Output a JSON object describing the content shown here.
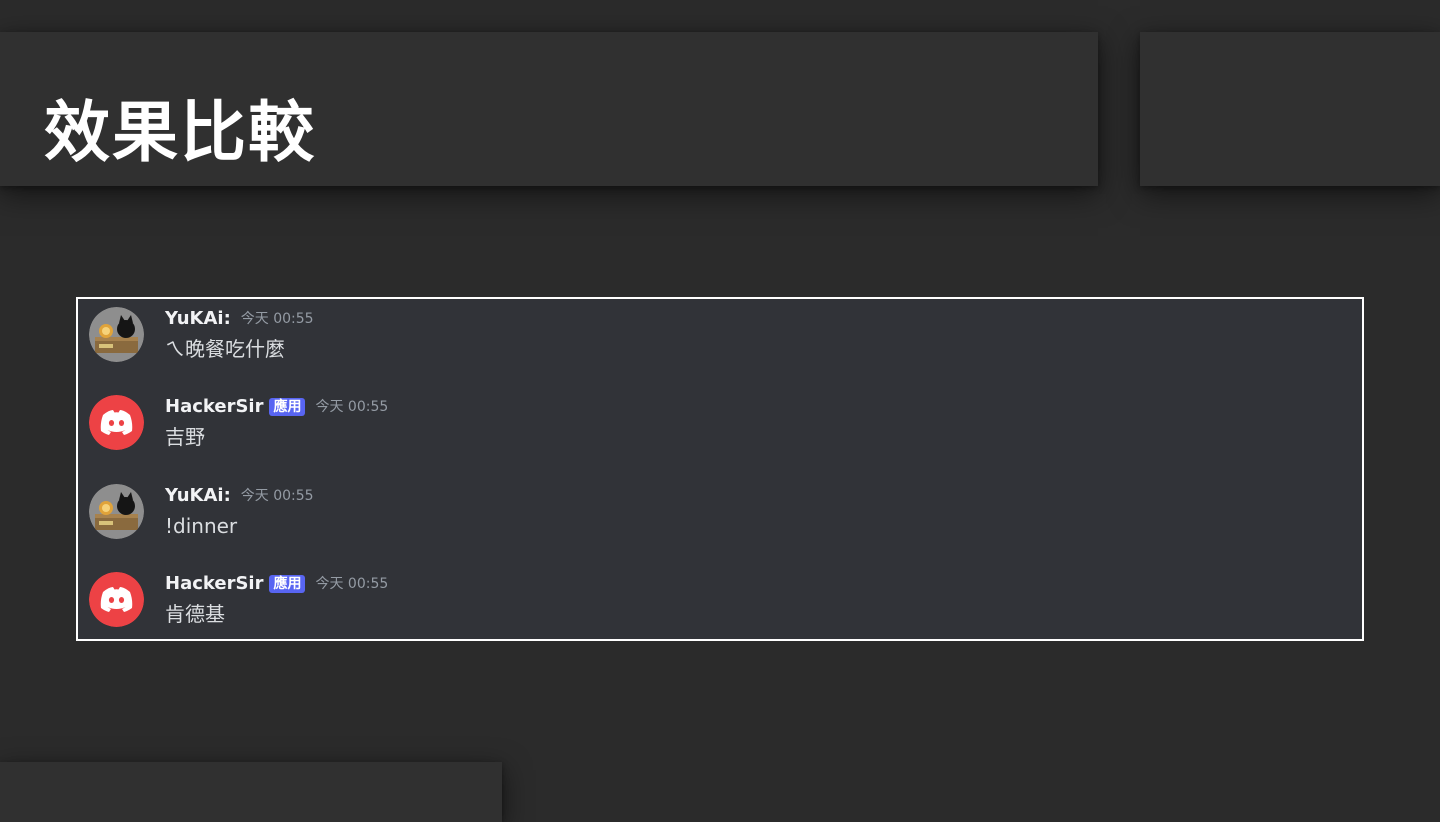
{
  "slide": {
    "title": "效果比較"
  },
  "colors": {
    "background": "#2b2b2b",
    "panel": "#303030",
    "chat_background": "#313338",
    "bot_tag": "#5865f2",
    "discord_avatar": "#ed4245"
  },
  "chat": {
    "messages": [
      {
        "author": "YuKAi:",
        "avatar_icon": "cat-astronaut-avatar",
        "timestamp": "今天 00:55",
        "text": "ㄟ晚餐吃什麼"
      },
      {
        "author": "HackerSir",
        "avatar_icon": "discord-logo-icon",
        "tag": "應用",
        "timestamp": "今天 00:55",
        "text": "吉野"
      },
      {
        "author": "YuKAi:",
        "avatar_icon": "cat-astronaut-avatar",
        "timestamp": "今天 00:55",
        "text": "!dinner"
      },
      {
        "author": "HackerSir",
        "avatar_icon": "discord-logo-icon",
        "tag": "應用",
        "timestamp": "今天 00:55",
        "text": "肯德基"
      }
    ]
  }
}
